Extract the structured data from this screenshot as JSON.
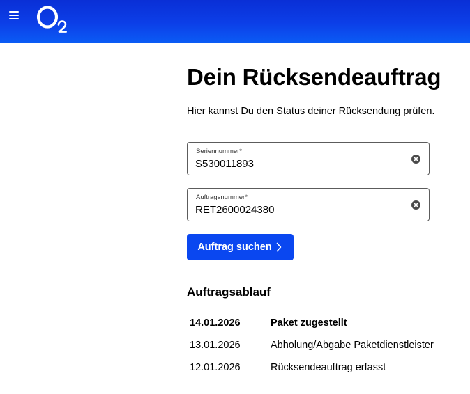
{
  "header": {
    "menu_icon": "hamburger-menu-icon",
    "logo_text": "O2",
    "brand_color": "#0c3fe8"
  },
  "main": {
    "title": "Dein Rücksendeauftrag",
    "subtitle": "Hier kannst Du den Status deiner Rücksendung prüfen.",
    "fields": [
      {
        "label": "Seriennummer*",
        "value": "S530011893",
        "clear_icon": "clear-circle-x-icon"
      },
      {
        "label": "Auftragsnummer*",
        "value": "RET2600024380",
        "clear_icon": "clear-circle-x-icon"
      }
    ],
    "search_button": {
      "label": "Auftrag suchen",
      "icon": "chevron-right-icon",
      "color": "#0a47f0"
    },
    "history": {
      "title": "Auftragsablauf",
      "rows": [
        {
          "date": "14.01.2026",
          "event": "Paket zugestellt",
          "current": true
        },
        {
          "date": "13.01.2026",
          "event": "Abholung/Abgabe Paketdienstleister",
          "current": false
        },
        {
          "date": "12.01.2026",
          "event": "Rücksendeauftrag erfasst",
          "current": false
        }
      ]
    }
  }
}
